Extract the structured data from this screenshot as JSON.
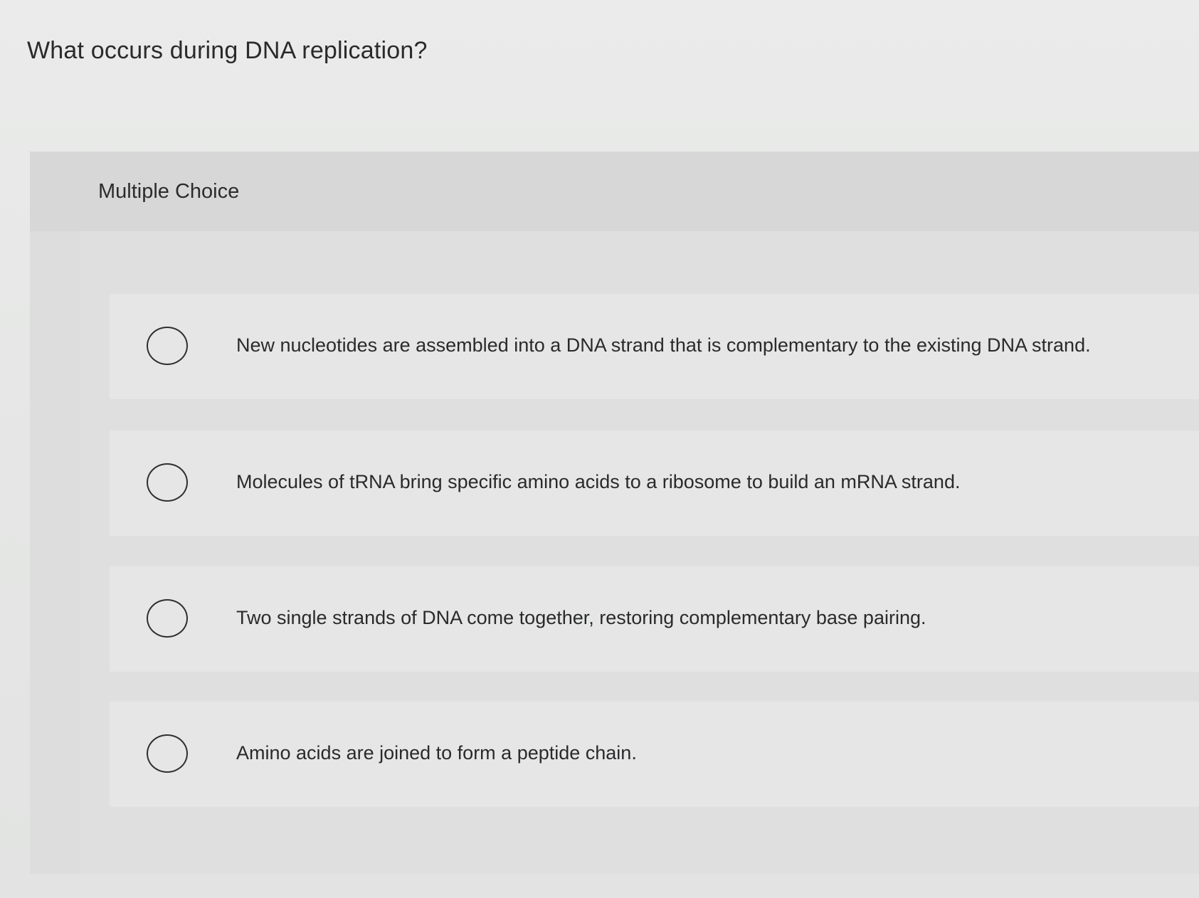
{
  "question": {
    "text": "What occurs during DNA replication?"
  },
  "panel": {
    "type_label": "Multiple Choice"
  },
  "choices": [
    {
      "text": "New nucleotides are assembled into a DNA strand that is complementary to the existing DNA strand.",
      "selected": false
    },
    {
      "text": "Molecules of tRNA bring specific amino acids to a ribosome to build an mRNA strand.",
      "selected": false
    },
    {
      "text": "Two single strands of DNA come together, restoring complementary base pairing.",
      "selected": false
    },
    {
      "text": "Amino acids are joined to form a peptide chain.",
      "selected": false
    }
  ]
}
